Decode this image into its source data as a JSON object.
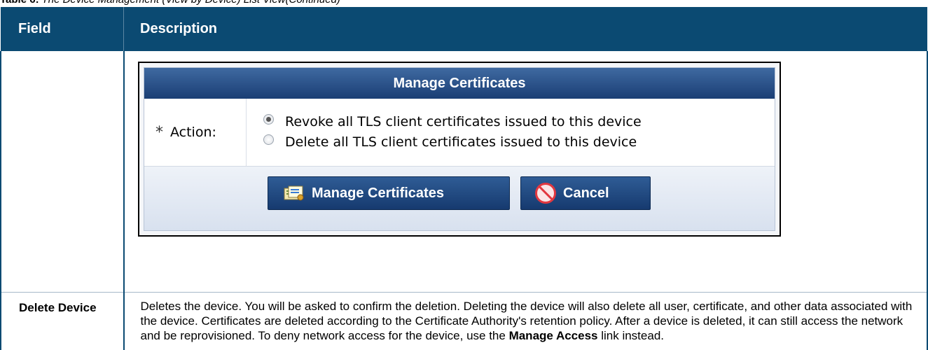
{
  "caption": {
    "label": "Table 6:",
    "text": "The Device Management (View by Device) List View(Continued)"
  },
  "table": {
    "headers": {
      "field": "Field",
      "description": "Description"
    },
    "rows": [
      {
        "field": "",
        "description": ""
      },
      {
        "field": "Delete Device",
        "description_pre": "Deletes the device. You will be asked to confirm the deletion. Deleting the device will also delete all user, certificate, and other data associated with the device. Certificates are deleted according to the Certificate Authority's retention policy. After a device is deleted, it can still access the network and be reprovisioned. To deny network access for the device, use the ",
        "description_bold": "Manage Access",
        "description_post": " link instead."
      }
    ]
  },
  "dialog": {
    "title": "Manage Certificates",
    "required_marker": "*",
    "action_label": "Action:",
    "options": [
      {
        "label": "Revoke all TLS client certificates issued to this device",
        "selected": true
      },
      {
        "label": "Delete all TLS client certificates issued to this device",
        "selected": false
      }
    ],
    "buttons": {
      "manage": "Manage Certificates",
      "cancel": "Cancel"
    }
  }
}
